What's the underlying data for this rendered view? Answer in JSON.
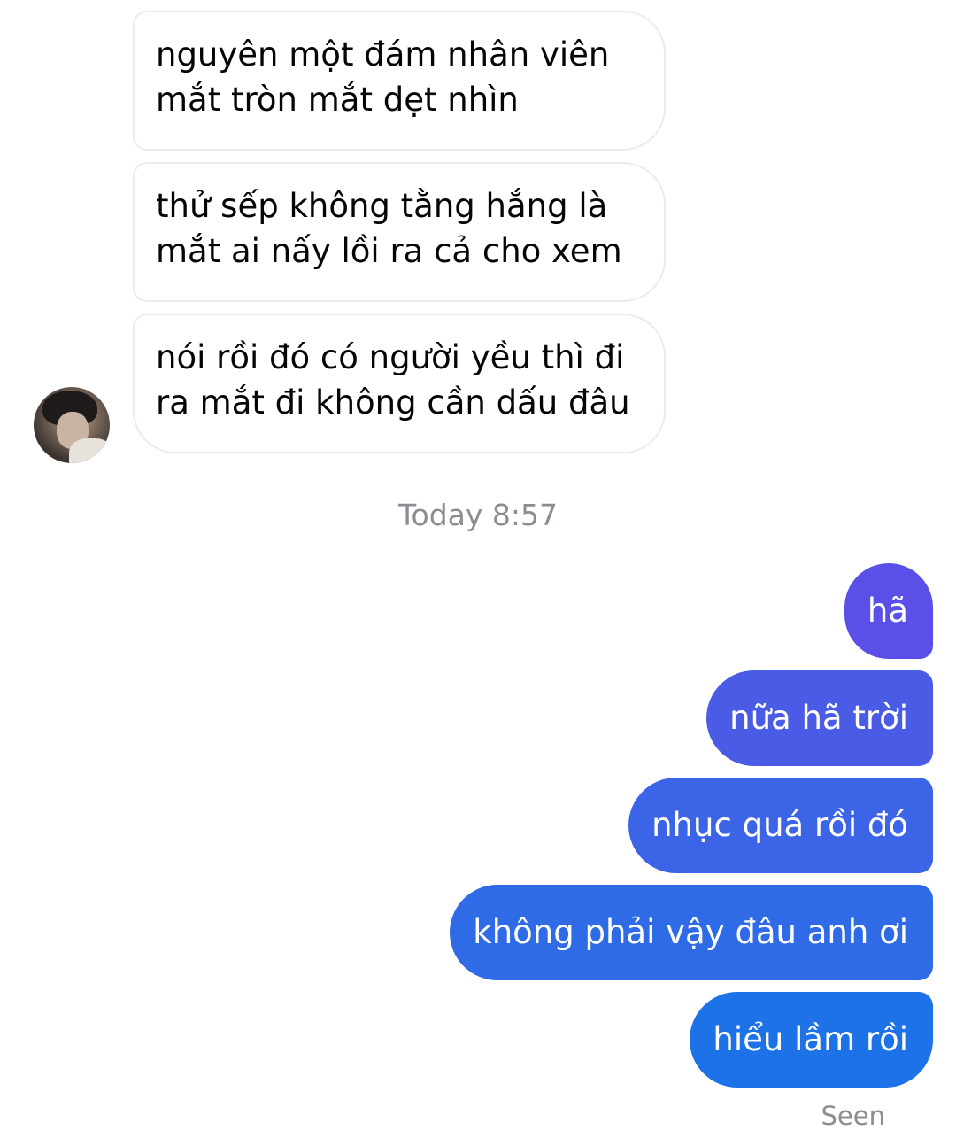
{
  "conversation": {
    "incoming": [
      {
        "text": "nguyên một đám nhân viên\nmắt tròn mắt dẹt nhìn"
      },
      {
        "text": "thử sếp không tằng hắng là\nmắt ai nấy lồi ra cả cho xem"
      },
      {
        "text": "nói rồi đó có người yều thì đi\nra mắt đi không cần dấu đâu"
      }
    ],
    "timestamp": "Today 8:57",
    "outgoing": [
      {
        "text": "hã",
        "color": "#5a50e8"
      },
      {
        "text": "nữa hã trời",
        "color": "#4a5be6"
      },
      {
        "text": "nhục quá rồi đó",
        "color": "#3c64e6"
      },
      {
        "text": "không phải vậy đâu anh ơi",
        "color": "#2f6be6"
      },
      {
        "text": "hiểu lầm rồi",
        "color": "#1d72e8"
      }
    ],
    "status": "Seen"
  },
  "colors": {
    "incoming_bubble_border": "#ececec",
    "incoming_text": "#050505",
    "meta_text": "#8a8d91"
  },
  "icons": {
    "avatar": "contact-avatar-photo"
  }
}
